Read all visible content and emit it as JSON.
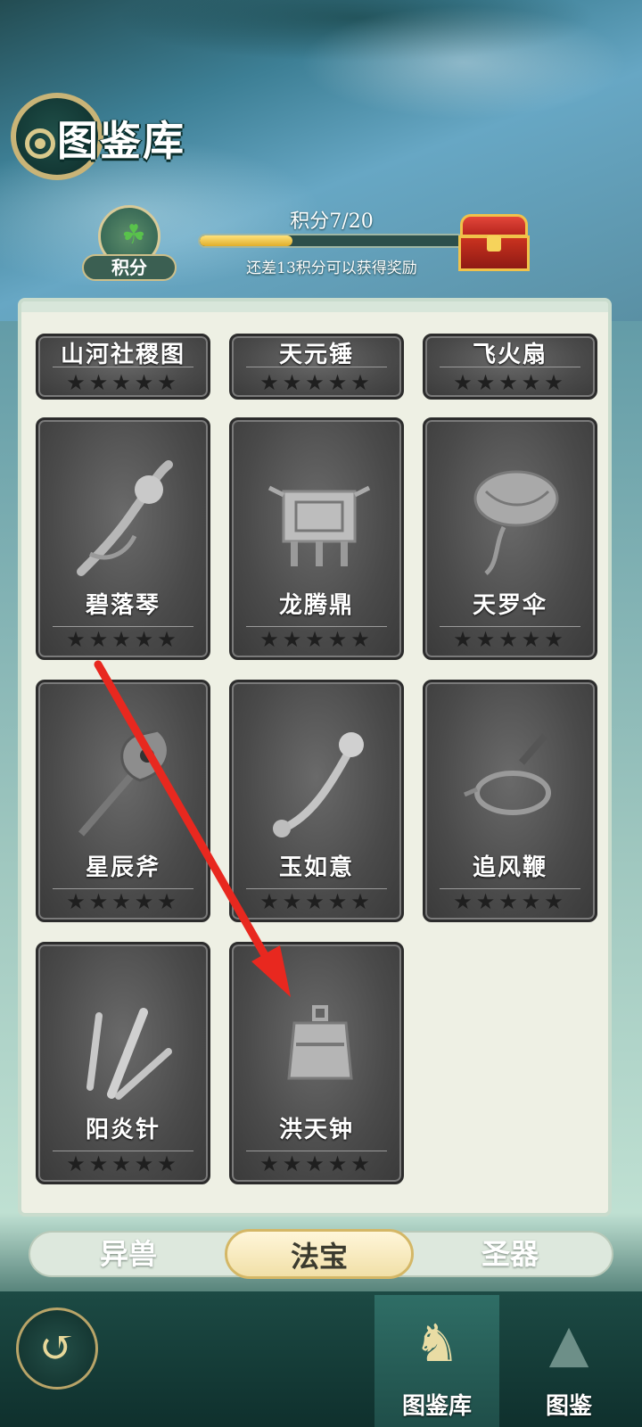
{
  "header": {
    "title": "图鉴库",
    "score_badge_label": "积分",
    "progress_text": "积分7/20",
    "progress_fraction": 0.35,
    "progress_hint": "还差13积分可以获得奖励"
  },
  "partial_cards": [
    {
      "name": "山河社稷图",
      "stars": "★★★★★"
    },
    {
      "name": "天元锤",
      "stars": "★★★★★"
    },
    {
      "name": "飞火扇",
      "stars": "★★★★★"
    }
  ],
  "cards": [
    {
      "name": "碧落琴",
      "stars": "★★★★★",
      "icon": "qin-icon"
    },
    {
      "name": "龙腾鼎",
      "stars": "★★★★★",
      "icon": "ding-icon"
    },
    {
      "name": "天罗伞",
      "stars": "★★★★★",
      "icon": "umbrella-icon"
    },
    {
      "name": "星辰斧",
      "stars": "★★★★★",
      "icon": "axe-icon"
    },
    {
      "name": "玉如意",
      "stars": "★★★★★",
      "icon": "ruyi-icon"
    },
    {
      "name": "追风鞭",
      "stars": "★★★★★",
      "icon": "whip-icon"
    },
    {
      "name": "阳炎针",
      "stars": "★★★★★",
      "icon": "needle-icon"
    },
    {
      "name": "洪天钟",
      "stars": "★★★★★",
      "icon": "bell-icon"
    }
  ],
  "tabs": [
    {
      "label": "异兽",
      "active": false
    },
    {
      "label": "法宝",
      "active": true
    },
    {
      "label": "圣器",
      "active": false
    }
  ],
  "bottom_nav": [
    {
      "label": "图鉴库",
      "active": true
    },
    {
      "label": "图鉴",
      "active": false
    }
  ],
  "colors": {
    "arrow": "#e8281f",
    "progress_fill": "#f0c040",
    "active_tab": "#f6ecc6"
  }
}
